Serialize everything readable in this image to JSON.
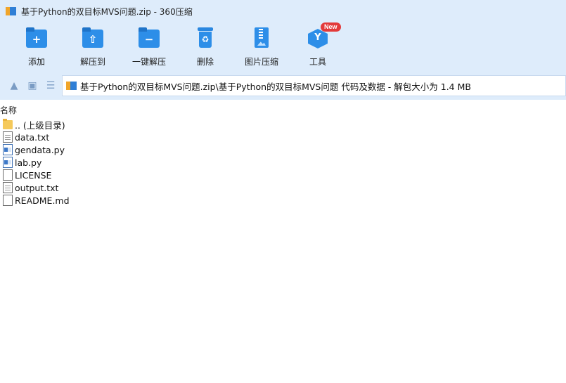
{
  "window": {
    "title": "基于Python的双目标MVS问题.zip - 360压缩"
  },
  "toolbar": {
    "items": [
      {
        "label": "添加",
        "icon": "add-folder-icon"
      },
      {
        "label": "解压到",
        "icon": "extract-to-icon"
      },
      {
        "label": "一键解压",
        "icon": "one-click-extract-icon"
      },
      {
        "label": "删除",
        "icon": "trash-icon"
      },
      {
        "label": "图片压缩",
        "icon": "image-compress-icon"
      },
      {
        "label": "工具",
        "icon": "tools-icon",
        "badge": "New"
      }
    ]
  },
  "nav": {
    "path_text": "基于Python的双目标MVS问题.zip\\基于Python的双目标MVS问题 代码及数据 - 解包大小为 1.4 MB"
  },
  "list": {
    "column_name": "名称",
    "files": [
      {
        "name": ".. (上级目录)",
        "icon": "parent-folder-icon"
      },
      {
        "name": "data.txt",
        "icon": "text-file-icon"
      },
      {
        "name": "gendata.py",
        "icon": "python-file-icon"
      },
      {
        "name": "lab.py",
        "icon": "python-file-icon"
      },
      {
        "name": "LICENSE",
        "icon": "file-icon"
      },
      {
        "name": "output.txt",
        "icon": "text-file-icon"
      },
      {
        "name": "README.md",
        "icon": "file-icon"
      }
    ]
  },
  "colors": {
    "chrome_bg": "#deecfb",
    "icon_blue": "#2d8ee8",
    "badge_red": "#e33a3a"
  }
}
